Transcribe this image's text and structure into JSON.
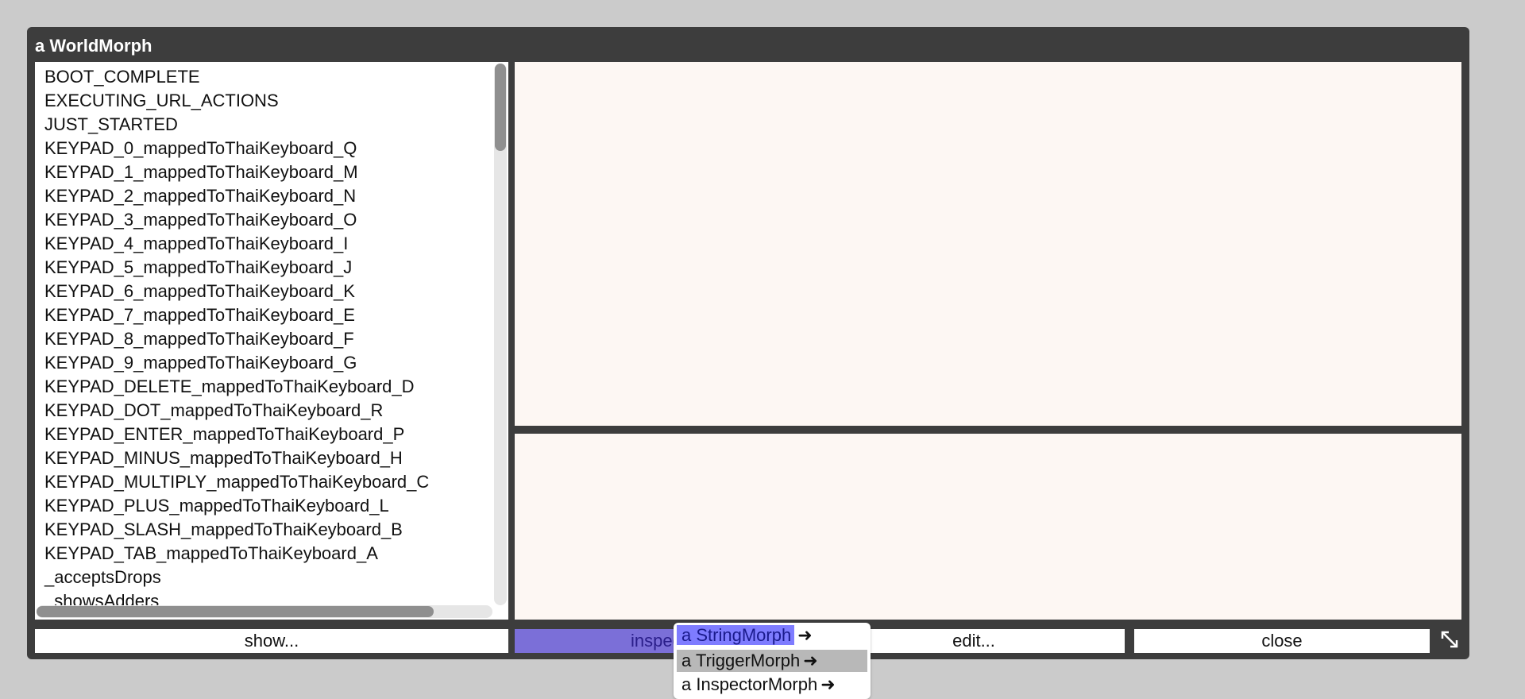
{
  "window": {
    "title": "a WorldMorph"
  },
  "list": {
    "items": [
      "BOOT_COMPLETE",
      "EXECUTING_URL_ACTIONS",
      "JUST_STARTED",
      "KEYPAD_0_mappedToThaiKeyboard_Q",
      "KEYPAD_1_mappedToThaiKeyboard_M",
      "KEYPAD_2_mappedToThaiKeyboard_N",
      "KEYPAD_3_mappedToThaiKeyboard_O",
      "KEYPAD_4_mappedToThaiKeyboard_I",
      "KEYPAD_5_mappedToThaiKeyboard_J",
      "KEYPAD_6_mappedToThaiKeyboard_K",
      "KEYPAD_7_mappedToThaiKeyboard_E",
      "KEYPAD_8_mappedToThaiKeyboard_F",
      "KEYPAD_9_mappedToThaiKeyboard_G",
      "KEYPAD_DELETE_mappedToThaiKeyboard_D",
      "KEYPAD_DOT_mappedToThaiKeyboard_R",
      "KEYPAD_ENTER_mappedToThaiKeyboard_P",
      "KEYPAD_MINUS_mappedToThaiKeyboard_H",
      "KEYPAD_MULTIPLY_mappedToThaiKeyboard_C",
      "KEYPAD_PLUS_mappedToThaiKeyboard_L",
      "KEYPAD_SLASH_mappedToThaiKeyboard_B",
      "KEYPAD_TAB_mappedToThaiKeyboard_A",
      "_acceptsDrops",
      "_showsAdders"
    ]
  },
  "buttons": {
    "show": "show...",
    "inspect": "inspect...",
    "edit": "edit...",
    "close": "close"
  },
  "menu": {
    "items": [
      {
        "label": "a StringMorph",
        "arrow": "➜"
      },
      {
        "label": "a TriggerMorph",
        "arrow": "➜"
      },
      {
        "label": "a InspectorMorph",
        "arrow": "➜"
      }
    ]
  },
  "icons": {
    "resize": "resize-icon"
  },
  "colors": {
    "window_frame": "#3d3d3d",
    "pane_background": "#fdf7f3",
    "selected_button": "#7b6fd8",
    "menu_highlight": "#7e7cff"
  }
}
